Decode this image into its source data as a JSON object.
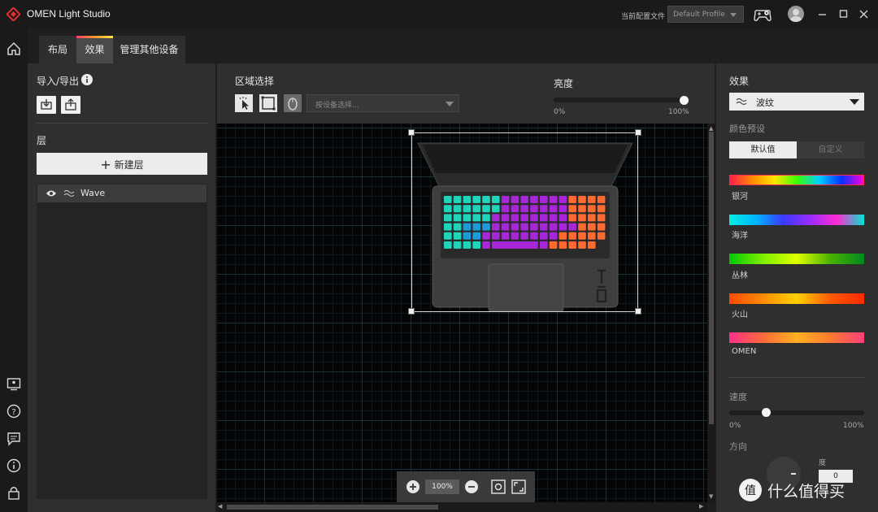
{
  "app": {
    "title": "OMEN Light Studio"
  },
  "titlebar": {
    "profile_label": "当前配置文件",
    "profile_value": "Default Profile"
  },
  "tabs": [
    {
      "label": "布局",
      "active": false
    },
    {
      "label": "效果",
      "active": true
    },
    {
      "label": "管理其他设备",
      "active": false
    }
  ],
  "left": {
    "import_export": "导入/导出",
    "layers_title": "层",
    "new_layer": "新建层",
    "layers": [
      {
        "name": "Wave",
        "visible": true,
        "icon": "wave-icon"
      }
    ]
  },
  "zone": {
    "title": "区域选择",
    "device_select_placeholder": "按设备选择..."
  },
  "brightness": {
    "title": "亮度",
    "min_label": "0%",
    "max_label": "100%",
    "value": 1.0
  },
  "zoom": {
    "value": "100%"
  },
  "effect": {
    "title": "效果",
    "selected": "波纹",
    "color_presets_title": "颜色预设",
    "preset_tabs": [
      {
        "label": "默认值",
        "active": true
      },
      {
        "label": "自定义",
        "active": false
      }
    ],
    "presets": [
      {
        "name": "银河",
        "colors": [
          "#ff1f4b",
          "#ff8a00",
          "#ffe600",
          "#3bff00",
          "#00d2ff",
          "#0033ff",
          "#ff00e0"
        ]
      },
      {
        "name": "海洋",
        "colors": [
          "#00f0e0",
          "#00b4ff",
          "#3a3aff",
          "#9a2cff",
          "#ff2cd0",
          "#00e6d0"
        ]
      },
      {
        "name": "丛林",
        "colors": [
          "#00c800",
          "#7ef000",
          "#e0ff00",
          "#49b000",
          "#008a20"
        ]
      },
      {
        "name": "火山",
        "colors": [
          "#ff4a00",
          "#ff8c00",
          "#ffd000",
          "#ff5a00",
          "#ff2a00"
        ]
      },
      {
        "name": "OMEN",
        "colors": [
          "#ff2f8a",
          "#ff6a3a",
          "#ffb020",
          "#ff7a30",
          "#ff3f7a"
        ]
      }
    ],
    "speed_title": "速度",
    "speed_min": "0%",
    "speed_max": "100%",
    "speed_value": 0.26,
    "direction_title": "方向",
    "degree_label": "度",
    "degree_value": "0"
  },
  "keyboard": {
    "colors": {
      "teal": "#1fd4b8",
      "purple": "#a626d8",
      "orange": "#ff6a30",
      "blue": "#1f9ad8"
    }
  },
  "watermark": {
    "text": "值 什么值得买",
    "icon": "smzdm-logo-icon"
  }
}
